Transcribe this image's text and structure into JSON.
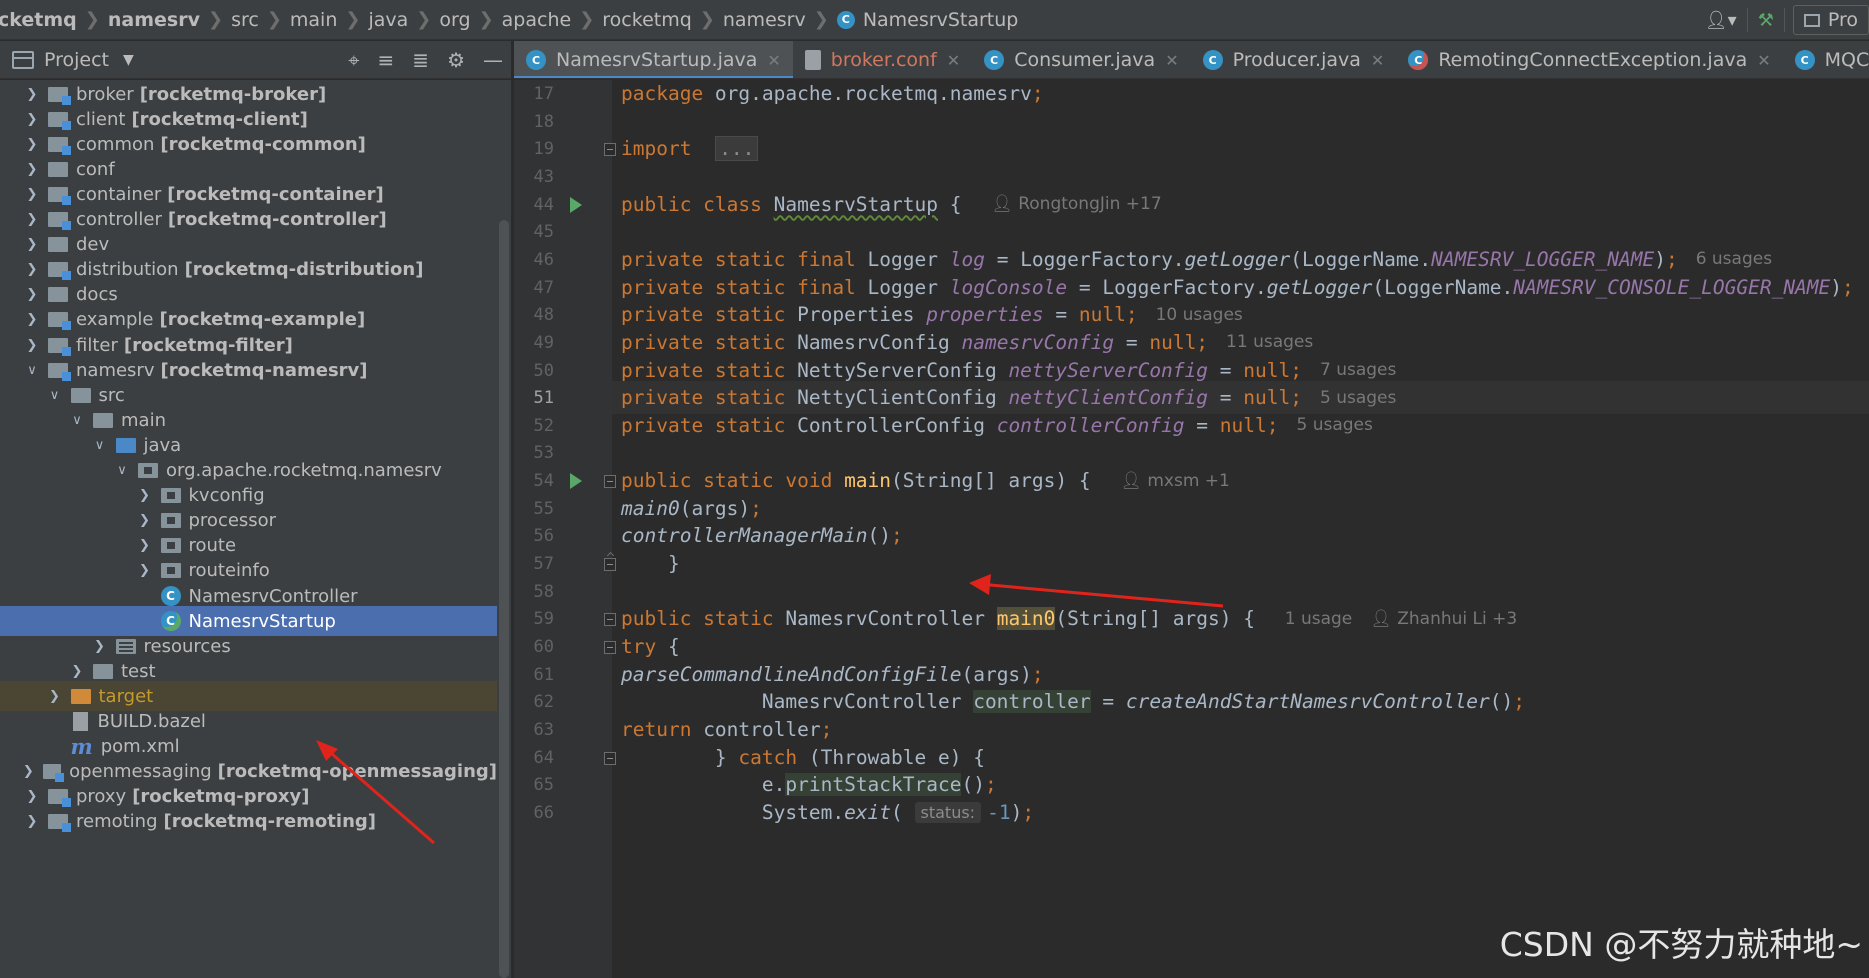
{
  "breadcrumb": [
    "cketmq",
    "namesrv",
    "src",
    "main",
    "java",
    "org",
    "apache",
    "rocketmq",
    "namesrv",
    "NamesrvStartup"
  ],
  "toolbar": {
    "run_config": "Pro"
  },
  "project_panel": {
    "title": "Project"
  },
  "tree": [
    {
      "depth": 0,
      "expand": "right",
      "icon": "module-folder-icon",
      "name": "broker",
      "module": "[rocketmq-broker]"
    },
    {
      "depth": 0,
      "expand": "right",
      "icon": "module-folder-icon",
      "name": "client",
      "module": "[rocketmq-client]"
    },
    {
      "depth": 0,
      "expand": "right",
      "icon": "module-folder-icon",
      "name": "common",
      "module": "[rocketmq-common]"
    },
    {
      "depth": 0,
      "expand": "right",
      "icon": "folder-icon",
      "name": "conf",
      "module": ""
    },
    {
      "depth": 0,
      "expand": "right",
      "icon": "module-folder-icon",
      "name": "container",
      "module": "[rocketmq-container]"
    },
    {
      "depth": 0,
      "expand": "right",
      "icon": "module-folder-icon",
      "name": "controller",
      "module": "[rocketmq-controller]"
    },
    {
      "depth": 0,
      "expand": "right",
      "icon": "folder-icon",
      "name": "dev",
      "module": ""
    },
    {
      "depth": 0,
      "expand": "right",
      "icon": "module-folder-icon",
      "name": "distribution",
      "module": "[rocketmq-distribution]"
    },
    {
      "depth": 0,
      "expand": "right",
      "icon": "folder-icon",
      "name": "docs",
      "module": ""
    },
    {
      "depth": 0,
      "expand": "right",
      "icon": "module-folder-icon",
      "name": "example",
      "module": "[rocketmq-example]"
    },
    {
      "depth": 0,
      "expand": "right",
      "icon": "module-folder-icon",
      "name": "filter",
      "module": "[rocketmq-filter]"
    },
    {
      "depth": 0,
      "expand": "down",
      "icon": "module-folder-icon",
      "name": "namesrv",
      "module": "[rocketmq-namesrv]"
    },
    {
      "depth": 1,
      "expand": "down",
      "icon": "folder-icon",
      "name": "src",
      "module": ""
    },
    {
      "depth": 2,
      "expand": "down",
      "icon": "folder-icon",
      "name": "main",
      "module": ""
    },
    {
      "depth": 3,
      "expand": "down",
      "icon": "source-folder-icon",
      "name": "java",
      "module": ""
    },
    {
      "depth": 4,
      "expand": "down",
      "icon": "package-icon",
      "name": "org.apache.rocketmq.namesrv",
      "module": ""
    },
    {
      "depth": 5,
      "expand": "right",
      "icon": "package-icon",
      "name": "kvconfig",
      "module": ""
    },
    {
      "depth": 5,
      "expand": "right",
      "icon": "package-icon",
      "name": "processor",
      "module": ""
    },
    {
      "depth": 5,
      "expand": "right",
      "icon": "package-icon",
      "name": "route",
      "module": ""
    },
    {
      "depth": 5,
      "expand": "right",
      "icon": "package-icon",
      "name": "routeinfo",
      "module": ""
    },
    {
      "depth": 5,
      "expand": "none",
      "icon": "class-icon",
      "name": "NamesrvController",
      "module": ""
    },
    {
      "depth": 5,
      "expand": "none",
      "icon": "runnable-class-icon",
      "name": "NamesrvStartup",
      "module": "",
      "selected": true
    },
    {
      "depth": 3,
      "expand": "right",
      "icon": "resources-folder-icon",
      "name": "resources",
      "module": ""
    },
    {
      "depth": 2,
      "expand": "right",
      "icon": "folder-icon",
      "name": "test",
      "module": ""
    },
    {
      "depth": 1,
      "expand": "right",
      "icon": "excluded-folder-icon",
      "name": "target",
      "module": "",
      "target": true
    },
    {
      "depth": 1,
      "expand": "none",
      "icon": "bazel-file-icon",
      "name": "BUILD.bazel",
      "module": ""
    },
    {
      "depth": 1,
      "expand": "none",
      "icon": "maven-icon",
      "name": "pom.xml",
      "module": ""
    },
    {
      "depth": 0,
      "expand": "right",
      "icon": "module-folder-icon",
      "name": "openmessaging",
      "module": "[rocketmq-openmessaging]"
    },
    {
      "depth": 0,
      "expand": "right",
      "icon": "module-folder-icon",
      "name": "proxy",
      "module": "[rocketmq-proxy]"
    },
    {
      "depth": 0,
      "expand": "right",
      "icon": "module-folder-icon",
      "name": "remoting",
      "module": "[rocketmq-remoting]"
    }
  ],
  "tabs": [
    {
      "label": "NamesrvStartup.java",
      "icon": "runnable-class-icon",
      "active": true
    },
    {
      "label": "broker.conf",
      "icon": "file-icon",
      "modified": true
    },
    {
      "label": "Consumer.java",
      "icon": "runnable-class-icon"
    },
    {
      "label": "Producer.java",
      "icon": "runnable-class-icon"
    },
    {
      "label": "RemotingConnectException.java",
      "icon": "exception-class-icon"
    },
    {
      "label": "MQClientInstan",
      "icon": "class-icon"
    }
  ],
  "editor": {
    "current_line": "51",
    "lines": [
      {
        "no": "17",
        "html": "<span class=\"kw\">package </span>org.apache.rocketmq.namesrv<span class=\"kw\">;</span>"
      },
      {
        "no": "18",
        "html": ""
      },
      {
        "no": "19",
        "html": "<span class=\"kw\">import </span><span class=\"collapsed\">...</span>",
        "fold": "start"
      },
      {
        "no": "43",
        "html": ""
      },
      {
        "no": "44",
        "html": "<span class=\"kw\">public class </span><span class=\"u-wave\">NamesrvStartup</span> { <span class=\"hint\">&#x1F464;&#xFE0E; RongtongJin +17</span>",
        "run": true
      },
      {
        "no": "45",
        "html": ""
      },
      {
        "no": "46",
        "html": "    <span class=\"kw\">private static final </span>Logger <span class=\"stc\">log</span> = LoggerFactory.<span class=\"stm\">getLogger</span>(LoggerName.<span class=\"stc\">NAMESRV_LOGGER_NAME</span>)<span class=\"kw\">;</span> <span class=\"hint\">6 usages</span>"
      },
      {
        "no": "47",
        "html": "    <span class=\"kw\">private static final </span>Logger <span class=\"stc\">logConsole</span> = LoggerFactory.<span class=\"stm\">getLogger</span>(LoggerName.<span class=\"stc\">NAMESRV_CONSOLE_LOGGER_NAME</span>)<span class=\"kw\">;</span>"
      },
      {
        "no": "48",
        "html": "    <span class=\"kw\">private static </span>Properties <span class=\"stc\">properties</span> = <span class=\"kw\">null;</span> <span class=\"hint\">10 usages</span>"
      },
      {
        "no": "49",
        "html": "    <span class=\"kw\">private static </span>NamesrvConfig <span class=\"stc\">namesrvConfig</span> = <span class=\"kw\">null;</span> <span class=\"hint\">11 usages</span>"
      },
      {
        "no": "50",
        "html": "    <span class=\"kw\">private static </span>NettyServerConfig <span class=\"stc\">nettyServerConfig</span> = <span class=\"kw\">null;</span> <span class=\"hint\">7 usages</span>"
      },
      {
        "no": "51",
        "html": "    <span class=\"kw\">private static </span>NettyClientConfig <span class=\"stc\">nettyClientConfig</span> = <span class=\"kw\">null;</span> <span class=\"hint\">5 usages</span>"
      },
      {
        "no": "52",
        "html": "    <span class=\"kw\">private static </span>ControllerConfig <span class=\"stc\">controllerConfig</span> = <span class=\"kw\">null;</span> <span class=\"hint\">5 usages</span>"
      },
      {
        "no": "53",
        "html": ""
      },
      {
        "no": "54",
        "html": "    <span class=\"kw\">public static void </span><span class=\"fn\">main</span>(String[] args) { <span class=\"hint\">&#x1F464;&#xFE0E; mxsm +1</span>",
        "run": true,
        "fold": "start"
      },
      {
        "no": "55",
        "html": "        <span class=\"stm\">main0</span>(args)<span class=\"kw\">;</span>"
      },
      {
        "no": "56",
        "html": "        <span class=\"stm\">controllerManagerMain</span>()<span class=\"kw\">;</span>"
      },
      {
        "no": "57",
        "html": "    }",
        "fold": "end"
      },
      {
        "no": "58",
        "html": ""
      },
      {
        "no": "59",
        "html": "    <span class=\"kw\">public static </span>NamesrvController <span class=\"fn hl-usage\">main0</span>(String[] args) { <span class=\"hint\">1 usage</span><span class=\"hint\">&#x1F464;&#xFE0E; Zhanhui Li +3</span>",
        "fold": "start"
      },
      {
        "no": "60",
        "html": "        <span class=\"kw\">try </span>{",
        "fold": "start"
      },
      {
        "no": "61",
        "html": "            <span class=\"stm\">parseCommandlineAndConfigFile</span>(args)<span class=\"kw\">;</span>"
      },
      {
        "no": "62",
        "html": "            NamesrvController <span class=\"hl-read\">controller</span> = <span class=\"stm\">createAndStartNamesrvController</span>()<span class=\"kw\">;</span>"
      },
      {
        "no": "63",
        "html": "            <span class=\"kw\">return </span>controller<span class=\"kw\">;</span>"
      },
      {
        "no": "64",
        "html": "        } <span class=\"kw\">catch </span>(Throwable e) {",
        "fold": "start"
      },
      {
        "no": "65",
        "html": "            e.<span class=\"hl-read\">printStackTrace</span>()<span class=\"kw\">;</span>"
      },
      {
        "no": "66",
        "html": "            System.<span class=\"stm\">exit</span>( <span class=\"hint-box\">status:</span><span class=\"num\">-1</span>)<span class=\"kw\">;</span>"
      }
    ]
  },
  "watermark": "CSDN @不努力就种地~"
}
